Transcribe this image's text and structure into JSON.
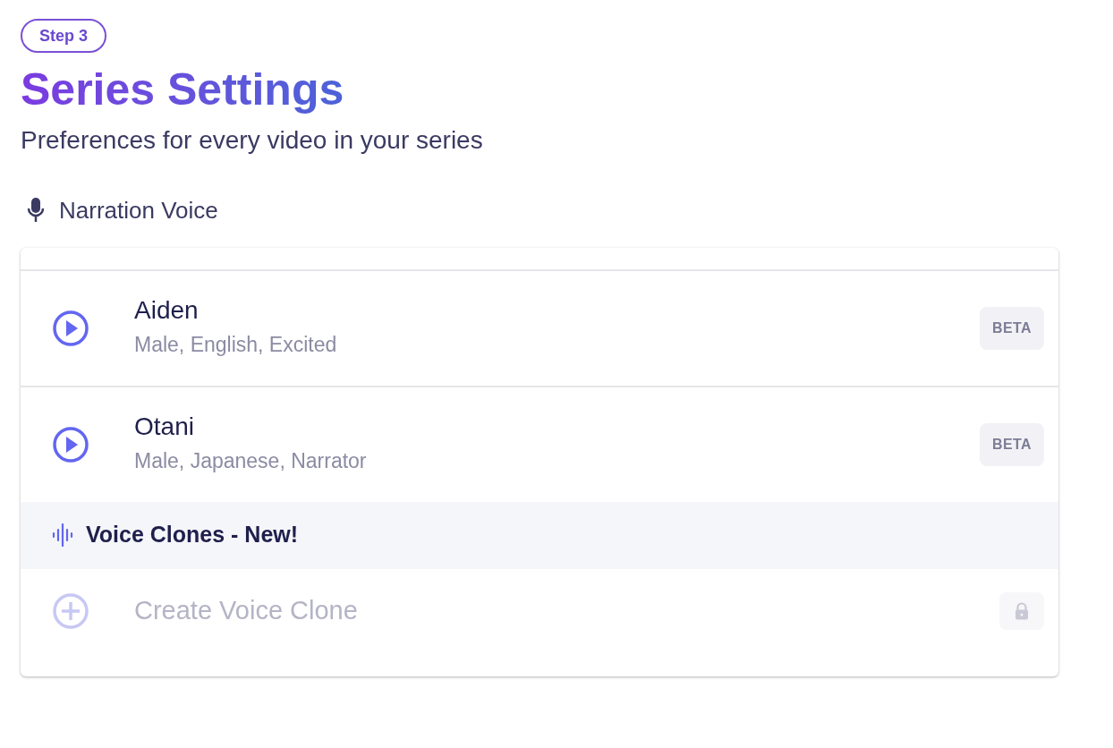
{
  "step_badge": "Step 3",
  "title": "Series Settings",
  "subtitle": "Preferences for every video in your series",
  "section_label": "Narration Voice",
  "voice_list": [
    {
      "kind": "voice",
      "name": "Aiden",
      "details": "Male, English, Excited",
      "badge": "BETA"
    },
    {
      "kind": "voice",
      "name": "Otani",
      "details": "Male, Japanese, Narrator",
      "badge": "BETA"
    },
    {
      "kind": "section",
      "name": "Voice Clones - New!"
    },
    {
      "kind": "create",
      "name": "Create Voice Clone",
      "disabled": true
    }
  ]
}
